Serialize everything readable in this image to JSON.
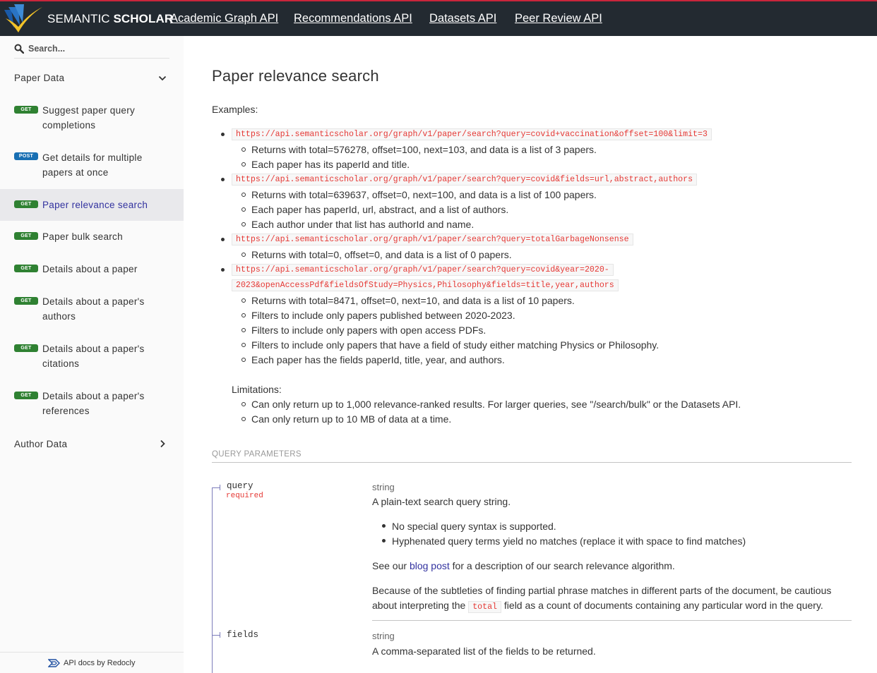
{
  "header": {
    "brand_light": "SEMANTIC",
    "brand_bold": "SCHOLAR",
    "nav": [
      "Academic Graph API",
      "Recommendations API",
      "Datasets API",
      "Peer Review API"
    ]
  },
  "sidebar": {
    "search_placeholder": "Search...",
    "group_paper": "Paper Data",
    "group_author": "Author Data",
    "items": [
      {
        "method": "GET",
        "label": "Suggest paper query completions"
      },
      {
        "method": "POST",
        "label": "Get details for multiple papers at once"
      },
      {
        "method": "GET",
        "label": "Paper relevance search"
      },
      {
        "method": "GET",
        "label": "Paper bulk search"
      },
      {
        "method": "GET",
        "label": "Details about a paper"
      },
      {
        "method": "GET",
        "label": "Details about a paper's authors"
      },
      {
        "method": "GET",
        "label": "Details about a paper's citations"
      },
      {
        "method": "GET",
        "label": "Details about a paper's references"
      }
    ],
    "footer": "API docs by Redocly"
  },
  "main": {
    "title": "Paper relevance search",
    "examples_label": "Examples:",
    "examples": [
      {
        "url": "https://api.semanticscholar.org/graph/v1/paper/search?query=covid+vaccination&offset=100&limit=3",
        "notes": [
          "Returns with total=576278, offset=100, next=103, and data is a list of 3 papers.",
          "Each paper has its paperId and title."
        ]
      },
      {
        "url": "https://api.semanticscholar.org/graph/v1/paper/search?query=covid&fields=url,abstract,authors",
        "notes": [
          "Returns with total=639637, offset=0, next=100, and data is a list of 100 papers.",
          "Each paper has paperId, url, abstract, and a list of authors.",
          "Each author under that list has authorId and name."
        ]
      },
      {
        "url": "https://api.semanticscholar.org/graph/v1/paper/search?query=totalGarbageNonsense",
        "notes": [
          "Returns with total=0, offset=0, and data is a list of 0 papers."
        ]
      },
      {
        "url_line1": "https://api.semanticscholar.org/graph/v1/paper/search?query=covid&year=2020-",
        "url_line2": "2023&openAccessPdf&fieldsOfStudy=Physics,Philosophy&fields=title,year,authors",
        "notes": [
          "Returns with total=8471, offset=0, next=10, and data is a list of 10 papers.",
          "Filters to include only papers published between 2020-2023.",
          "Filters to include only papers with open access PDFs.",
          "Filters to include only papers that have a field of study either matching Physics or Philosophy.",
          "Each paper has the fields paperId, title, year, and authors."
        ]
      }
    ],
    "limitations_label": "Limitations:",
    "limitations": [
      "Can only return up to 1,000 relevance-ranked results. For larger queries, see \"/search/bulk\" or the Datasets API.",
      "Can only return up to 10 MB of data at a time."
    ],
    "query_params_label": "QUERY PARAMETERS",
    "params": [
      {
        "name": "query",
        "required": "required",
        "type": "string",
        "description": "A plain-text search query string.",
        "bullets": [
          "No special query syntax is supported.",
          "Hyphenated query terms yield no matches (replace it with space to find matches)"
        ],
        "see_pre": "See our",
        "see_link": "blog post",
        "see_post": "for a description of our search relevance algorithm.",
        "caution_line1": "Because of the subtleties of finding partial phrase matches in different parts of the document, be cautious",
        "caution_pre": "about interpreting the",
        "caution_code": "total",
        "caution_post": "field as a count of documents containing any particular word in the query."
      },
      {
        "name": "fields",
        "type": "string",
        "description": "A comma-separated list of the fields to be returned."
      }
    ]
  }
}
